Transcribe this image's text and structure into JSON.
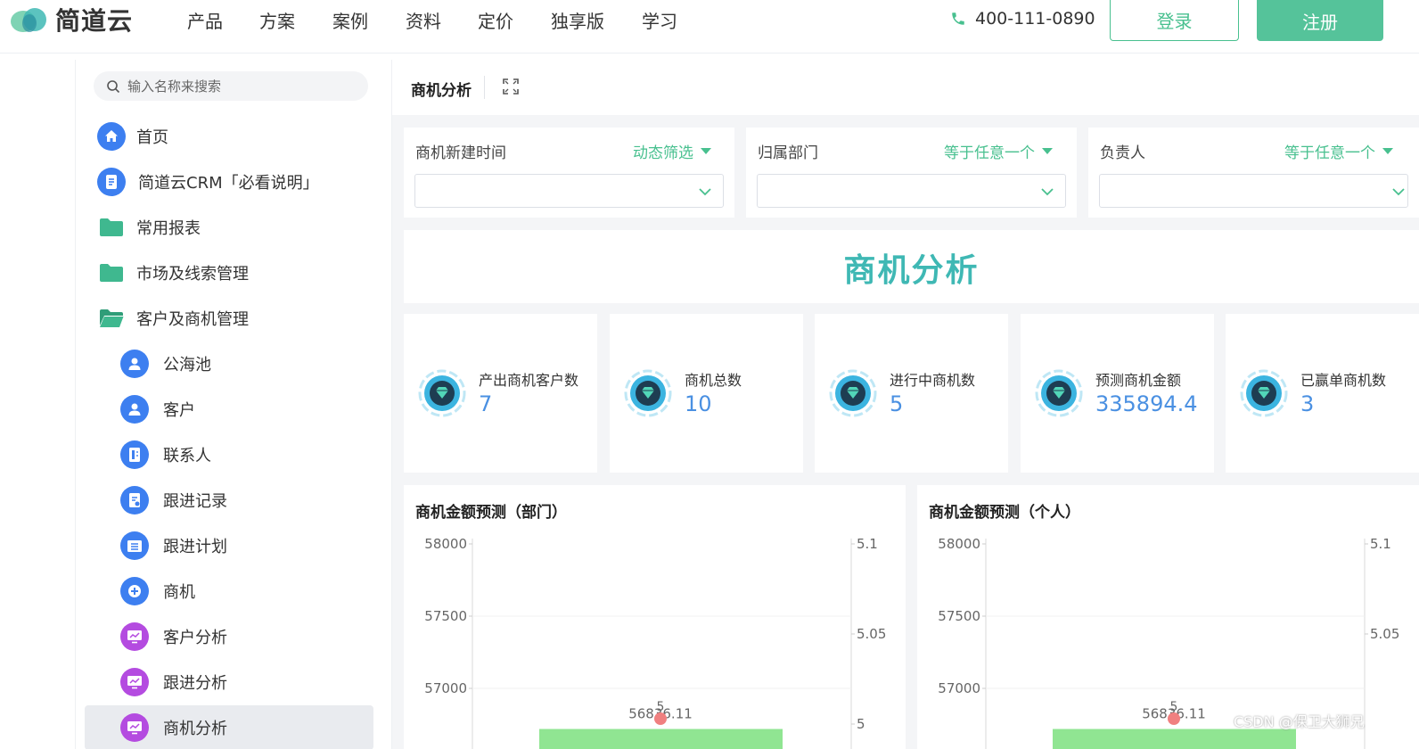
{
  "brand": {
    "name": "简道云",
    "accent": "#48c08f",
    "logo": "leaf-logo"
  },
  "topnav": {
    "items": [
      "产品",
      "方案",
      "案例",
      "资料",
      "定价",
      "独享版",
      "学习"
    ],
    "phone": "400-111-0890",
    "login": "登录",
    "register": "注册"
  },
  "sidebar": {
    "search_placeholder": "输入名称来搜索",
    "items": [
      {
        "label": "首页",
        "icon": "home-icon"
      },
      {
        "label": "简道云CRM「必看说明」",
        "icon": "document-icon"
      },
      {
        "label": "常用报表",
        "icon": "folder-icon"
      },
      {
        "label": "市场及线索管理",
        "icon": "folder-icon"
      },
      {
        "label": "客户及商机管理",
        "icon": "folder-open-icon"
      },
      {
        "label": "公海池",
        "icon": "user-pool-icon"
      },
      {
        "label": "客户",
        "icon": "user-icon"
      },
      {
        "label": "联系人",
        "icon": "contact-icon"
      },
      {
        "label": "跟进记录",
        "icon": "record-icon"
      },
      {
        "label": "跟进计划",
        "icon": "plan-icon"
      },
      {
        "label": "商机",
        "icon": "opportunity-icon"
      },
      {
        "label": "客户分析",
        "icon": "chart-icon"
      },
      {
        "label": "跟进分析",
        "icon": "chart-icon"
      },
      {
        "label": "商机分析",
        "icon": "chart-icon",
        "active": true
      }
    ]
  },
  "main": {
    "title": "商机分析",
    "filters": [
      {
        "label": "商机新建时间",
        "mode": "动态筛选",
        "value": ""
      },
      {
        "label": "归属部门",
        "mode": "等于任意一个",
        "value": ""
      },
      {
        "label": "负责人",
        "mode": "等于任意一个",
        "value": ""
      }
    ],
    "banner_title": "商机分析",
    "kpis": [
      {
        "label": "产出商机客户数",
        "value": "7"
      },
      {
        "label": "商机总数",
        "value": "10"
      },
      {
        "label": "进行中商机数",
        "value": "5"
      },
      {
        "label": "预测商机金额",
        "value": "335894.4"
      },
      {
        "label": "已赢单商机数",
        "value": "3"
      }
    ]
  },
  "chart_data": [
    {
      "type": "bar",
      "title": "商机金额预测（部门）",
      "left_axis_ticks": [
        "58000",
        "57500",
        "57000"
      ],
      "right_axis_ticks": [
        "5.1",
        "5.05",
        "5"
      ],
      "ylim_left": [
        56700,
        58000
      ],
      "ylim_right": [
        4.99,
        5.1
      ],
      "series": [
        {
          "type": "bar",
          "values": [
            56836.11
          ],
          "color": "#90e592"
        },
        {
          "type": "line",
          "values": [
            5
          ],
          "color": "#f08080"
        }
      ],
      "data_labels": [
        "56836.11",
        "5"
      ]
    },
    {
      "type": "bar",
      "title": "商机金额预测（个人）",
      "left_axis_ticks": [
        "58000",
        "57500",
        "57000"
      ],
      "right_axis_ticks": [
        "5.1",
        "5.05"
      ],
      "ylim_left": [
        56700,
        58000
      ],
      "ylim_right": [
        4.99,
        5.1
      ],
      "series": [
        {
          "type": "bar",
          "values": [
            56836.11
          ],
          "color": "#90e592"
        },
        {
          "type": "line",
          "values": [
            5
          ],
          "color": "#f08080"
        }
      ],
      "data_labels": [
        "56836.11",
        "5"
      ]
    }
  ],
  "watermark": "CSDN @保卫大狮兄"
}
